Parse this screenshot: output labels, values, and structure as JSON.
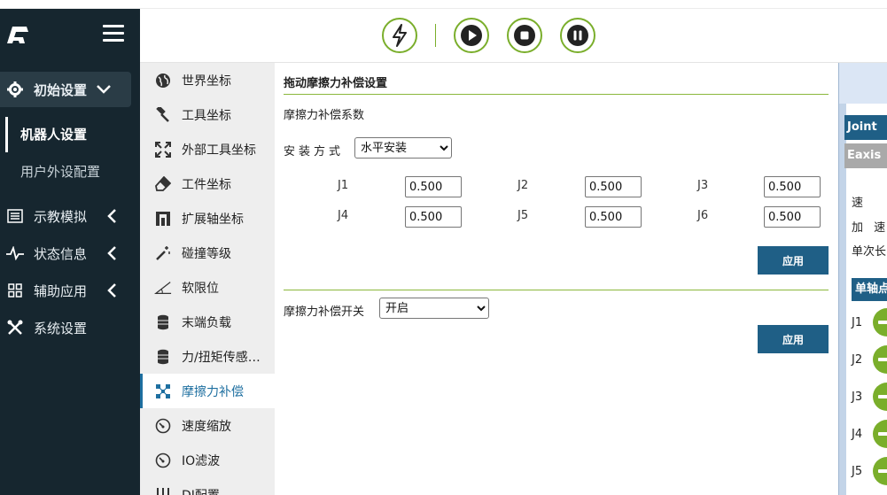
{
  "nav": {
    "init_label": "初始设置",
    "robot_settings": "机器人设置",
    "user_peripheral": "用户外设配置",
    "teach_label": "示教模拟",
    "status_label": "状态信息",
    "aux_label": "辅助应用",
    "system_label": "系统设置"
  },
  "submenu": [
    {
      "label": "世界坐标",
      "icon": "globe-icon"
    },
    {
      "label": "工具坐标",
      "icon": "wrench-icon"
    },
    {
      "label": "外部工具坐标",
      "icon": "expand-icon"
    },
    {
      "label": "工件坐标",
      "icon": "eraser-icon"
    },
    {
      "label": "扩展轴坐标",
      "icon": "axis-icon"
    },
    {
      "label": "碰撞等级",
      "icon": "magic-wand-icon"
    },
    {
      "label": "软限位",
      "icon": "angle-icon"
    },
    {
      "label": "末端负载",
      "icon": "database-icon"
    },
    {
      "label": "力/扭矩传感…",
      "icon": "database-icon"
    },
    {
      "label": "摩擦力补偿",
      "icon": "network-icon"
    },
    {
      "label": "速度缩放",
      "icon": "gauge-icon"
    },
    {
      "label": "IO滤波",
      "icon": "gauge-icon"
    },
    {
      "label": "DI配置",
      "icon": "sliders-icon"
    }
  ],
  "content": {
    "title": "拖动摩擦力补偿设置",
    "coef_label": "摩擦力补偿系数",
    "mount_label": "安装方式",
    "mount_value": "水平安装",
    "joints": [
      {
        "label": "J1",
        "value": "0.500"
      },
      {
        "label": "J2",
        "value": "0.500"
      },
      {
        "label": "J3",
        "value": "0.500"
      },
      {
        "label": "J4",
        "value": "0.500"
      },
      {
        "label": "J5",
        "value": "0.500"
      },
      {
        "label": "J6",
        "value": "0.500"
      }
    ],
    "apply_label": "应用",
    "switch_label": "摩擦力补偿开关",
    "switch_value": "开启"
  },
  "right_panel": {
    "tab_joint": "Joint",
    "tab_eaxis": "Eaxis",
    "speed": "速",
    "accel": "加 速",
    "single_len": "单次长",
    "single_axis": "单轴点",
    "joints": [
      "J1",
      "J2",
      "J3",
      "J4",
      "J5"
    ]
  },
  "colors": {
    "nav_bg": "#16262f",
    "accent_green": "#7aae2b",
    "accent_blue": "#1f5f86",
    "submenu_bg": "#eeeeee"
  }
}
